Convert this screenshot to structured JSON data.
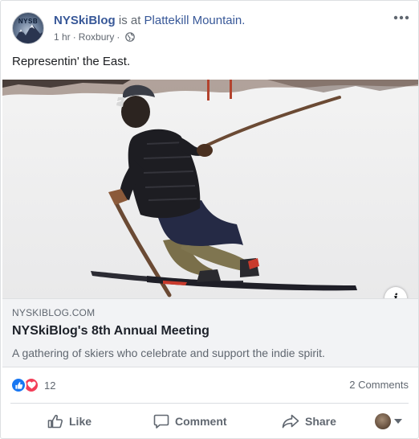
{
  "post": {
    "avatar_text": "NYSB",
    "page_name": "NYSkiBlog",
    "connector": " is at ",
    "location": "Plattekill Mountain.",
    "time": "1 hr",
    "separator": "·",
    "place": "Roxbury",
    "privacy_icon": "globe-icon",
    "menu_icon": "more-options-icon",
    "caption": "Representin' the East."
  },
  "link_preview": {
    "image_alt": "Skier with wooden stick",
    "info_label": "i",
    "domain": "NYSKIBLOG.COM",
    "headline": "NYSkiBlog's 8th Annual Meeting",
    "description": "A gathering of skiers who celebrate and support the indie spirit."
  },
  "engagement": {
    "reactions": [
      "like",
      "love"
    ],
    "reaction_count": "12",
    "comments": "2 Comments"
  },
  "actions": {
    "like": "Like",
    "comment": "Comment",
    "share": "Share"
  },
  "colors": {
    "link_blue": "#385898",
    "like_blue": "#1877f2",
    "love_red": "#f33e58",
    "secondary_text": "#606770"
  }
}
